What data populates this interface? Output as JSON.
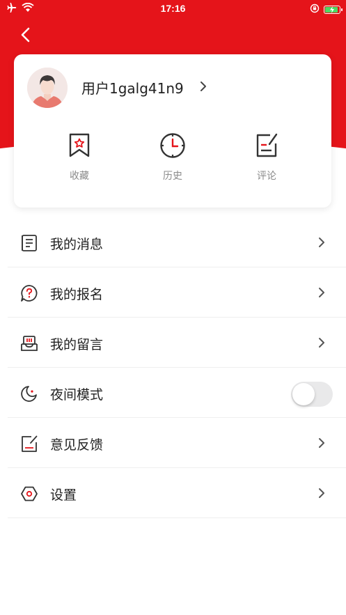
{
  "status_bar": {
    "time": "17:16",
    "icons": [
      "airplane-icon",
      "wifi-icon",
      "orientation-lock-icon",
      "battery-charging-icon"
    ]
  },
  "header": {
    "back_icon": "chevron-left-icon",
    "brand_color": "#e5141a"
  },
  "profile": {
    "username": "用户1galg41n9",
    "avatar_icon": "user-avatar",
    "chevron_icon": "chevron-right-icon"
  },
  "quick_actions": [
    {
      "label": "收藏",
      "icon": "bookmark-star-icon"
    },
    {
      "label": "历史",
      "icon": "clock-icon"
    },
    {
      "label": "评论",
      "icon": "edit-note-icon"
    }
  ],
  "menu": [
    {
      "label": "我的消息",
      "icon": "document-list-icon",
      "trailing": "chevron"
    },
    {
      "label": "我的报名",
      "icon": "question-bubble-icon",
      "trailing": "chevron"
    },
    {
      "label": "我的留言",
      "icon": "message-tray-icon",
      "trailing": "chevron"
    },
    {
      "label": "夜间模式",
      "icon": "moon-icon",
      "trailing": "toggle",
      "toggle_on": false
    },
    {
      "label": "意见反馈",
      "icon": "feedback-edit-icon",
      "trailing": "chevron"
    },
    {
      "label": "设置",
      "icon": "hexagon-settings-icon",
      "trailing": "chevron"
    }
  ],
  "colors": {
    "accent": "#e5141a",
    "text": "#222222",
    "muted": "#8a8a8a",
    "icon_stroke": "#333333"
  }
}
